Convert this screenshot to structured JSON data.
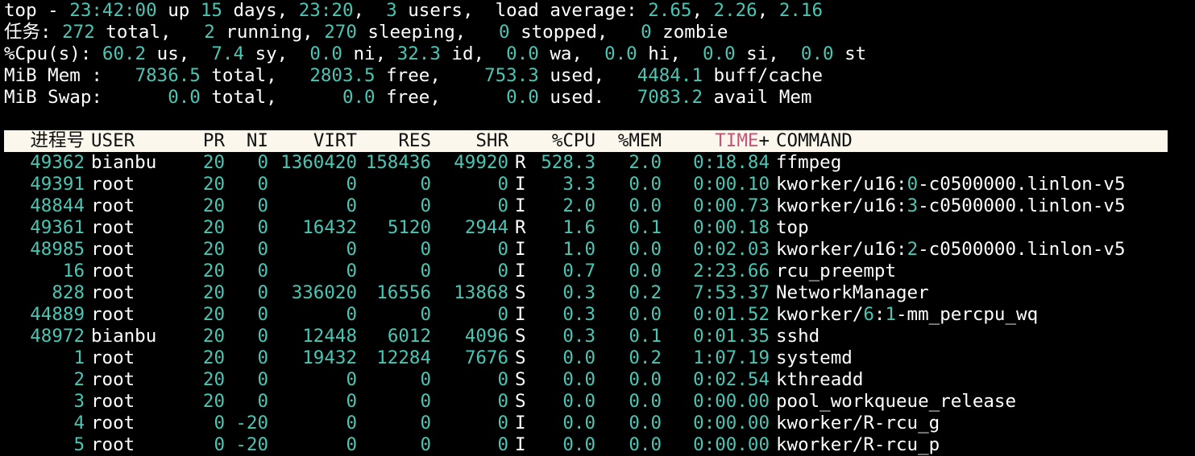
{
  "summary": {
    "line1": [
      {
        "t": "top - ",
        "c": "plain"
      },
      {
        "t": "23:42:00",
        "c": "num"
      },
      {
        "t": " up ",
        "c": "plain"
      },
      {
        "t": "15",
        "c": "num"
      },
      {
        "t": " days, ",
        "c": "plain"
      },
      {
        "t": "23:20",
        "c": "num"
      },
      {
        "t": ",  ",
        "c": "plain"
      },
      {
        "t": "3",
        "c": "num"
      },
      {
        "t": " users,  load average: ",
        "c": "plain"
      },
      {
        "t": "2.65",
        "c": "num"
      },
      {
        "t": ", ",
        "c": "plain"
      },
      {
        "t": "2.26",
        "c": "num"
      },
      {
        "t": ", ",
        "c": "plain"
      },
      {
        "t": "2.16",
        "c": "num"
      }
    ],
    "line2": [
      {
        "t": "任务",
        "c": "plain"
      },
      {
        "t": ": ",
        "c": "plain"
      },
      {
        "t": "272",
        "c": "num"
      },
      {
        "t": " total,   ",
        "c": "plain"
      },
      {
        "t": "2",
        "c": "num"
      },
      {
        "t": " running, ",
        "c": "plain"
      },
      {
        "t": "270",
        "c": "num"
      },
      {
        "t": " sleeping,   ",
        "c": "plain"
      },
      {
        "t": "0",
        "c": "num"
      },
      {
        "t": " stopped,   ",
        "c": "plain"
      },
      {
        "t": "0",
        "c": "num"
      },
      {
        "t": " zombie",
        "c": "plain"
      }
    ],
    "line3": [
      {
        "t": "%Cpu(s): ",
        "c": "plain"
      },
      {
        "t": "60.2",
        "c": "num"
      },
      {
        "t": " us,  ",
        "c": "plain"
      },
      {
        "t": "7.4",
        "c": "num"
      },
      {
        "t": " sy,  ",
        "c": "plain"
      },
      {
        "t": "0.0",
        "c": "num"
      },
      {
        "t": " ni, ",
        "c": "plain"
      },
      {
        "t": "32.3",
        "c": "num"
      },
      {
        "t": " id,  ",
        "c": "plain"
      },
      {
        "t": "0.0",
        "c": "num"
      },
      {
        "t": " wa,  ",
        "c": "plain"
      },
      {
        "t": "0.0",
        "c": "num"
      },
      {
        "t": " hi,  ",
        "c": "plain"
      },
      {
        "t": "0.0",
        "c": "num"
      },
      {
        "t": " si,  ",
        "c": "plain"
      },
      {
        "t": "0.0",
        "c": "num"
      },
      {
        "t": " st",
        "c": "plain"
      }
    ],
    "line4": [
      {
        "t": "MiB Mem :   ",
        "c": "plain"
      },
      {
        "t": "7836.5",
        "c": "num"
      },
      {
        "t": " total,   ",
        "c": "plain"
      },
      {
        "t": "2803.5",
        "c": "num"
      },
      {
        "t": " free,    ",
        "c": "plain"
      },
      {
        "t": "753.3",
        "c": "num"
      },
      {
        "t": " used,   ",
        "c": "plain"
      },
      {
        "t": "4484.1",
        "c": "num"
      },
      {
        "t": " buff/cache",
        "c": "plain"
      }
    ],
    "line5": [
      {
        "t": "MiB Swap:      ",
        "c": "plain"
      },
      {
        "t": "0.0",
        "c": "num"
      },
      {
        "t": " total,      ",
        "c": "plain"
      },
      {
        "t": "0.0",
        "c": "num"
      },
      {
        "t": " free,      ",
        "c": "plain"
      },
      {
        "t": "0.0",
        "c": "num"
      },
      {
        "t": " used.   ",
        "c": "plain"
      },
      {
        "t": "7083.2",
        "c": "num"
      },
      {
        "t": " avail Mem",
        "c": "plain"
      }
    ]
  },
  "table": {
    "headers": {
      "pid": "进程号",
      "user": "USER",
      "pr": "PR",
      "ni": "NI",
      "virt": "VIRT",
      "res": "RES",
      "shr": "SHR",
      "s": "",
      "cpu": "%CPU",
      "mem": "%MEM",
      "time_sorted": "TIME",
      "time_plus": "+",
      "command": "COMMAND"
    },
    "rows": [
      {
        "pid": "49362",
        "user": "bianbu",
        "pr": "20",
        "ni": "0",
        "virt": "1360420",
        "res": "158436",
        "shr": "49920",
        "s": "R",
        "cpu": "528.3",
        "mem": "2.0",
        "time": "0:18.84",
        "command": [
          {
            "t": "ffmpeg",
            "c": "w"
          }
        ]
      },
      {
        "pid": "49391",
        "user": "root",
        "pr": "20",
        "ni": "0",
        "virt": "0",
        "res": "0",
        "shr": "0",
        "s": "I",
        "cpu": "3.3",
        "mem": "0.0",
        "time": "0:00.10",
        "command": [
          {
            "t": "kworker/u16:",
            "c": "w"
          },
          {
            "t": "0",
            "c": "n"
          },
          {
            "t": "-c0500000.linlon-v5",
            "c": "w"
          }
        ]
      },
      {
        "pid": "48844",
        "user": "root",
        "pr": "20",
        "ni": "0",
        "virt": "0",
        "res": "0",
        "shr": "0",
        "s": "I",
        "cpu": "2.0",
        "mem": "0.0",
        "time": "0:00.73",
        "command": [
          {
            "t": "kworker/u16:",
            "c": "w"
          },
          {
            "t": "3",
            "c": "n"
          },
          {
            "t": "-c0500000.linlon-v5",
            "c": "w"
          }
        ]
      },
      {
        "pid": "49361",
        "user": "root",
        "pr": "20",
        "ni": "0",
        "virt": "16432",
        "res": "5120",
        "shr": "2944",
        "s": "R",
        "cpu": "1.6",
        "mem": "0.1",
        "time": "0:00.18",
        "command": [
          {
            "t": "top",
            "c": "w"
          }
        ]
      },
      {
        "pid": "48985",
        "user": "root",
        "pr": "20",
        "ni": "0",
        "virt": "0",
        "res": "0",
        "shr": "0",
        "s": "I",
        "cpu": "1.0",
        "mem": "0.0",
        "time": "0:02.03",
        "command": [
          {
            "t": "kworker/u16:",
            "c": "w"
          },
          {
            "t": "2",
            "c": "n"
          },
          {
            "t": "-c0500000.linlon-v5",
            "c": "w"
          }
        ]
      },
      {
        "pid": "16",
        "user": "root",
        "pr": "20",
        "ni": "0",
        "virt": "0",
        "res": "0",
        "shr": "0",
        "s": "I",
        "cpu": "0.7",
        "mem": "0.0",
        "time": "2:23.66",
        "command": [
          {
            "t": "rcu_preempt",
            "c": "w"
          }
        ]
      },
      {
        "pid": "828",
        "user": "root",
        "pr": "20",
        "ni": "0",
        "virt": "336020",
        "res": "16556",
        "shr": "13868",
        "s": "S",
        "cpu": "0.3",
        "mem": "0.2",
        "time": "7:53.37",
        "command": [
          {
            "t": "NetworkManager",
            "c": "w"
          }
        ]
      },
      {
        "pid": "44889",
        "user": "root",
        "pr": "20",
        "ni": "0",
        "virt": "0",
        "res": "0",
        "shr": "0",
        "s": "I",
        "cpu": "0.3",
        "mem": "0.0",
        "time": "0:01.52",
        "command": [
          {
            "t": "kworker/",
            "c": "w"
          },
          {
            "t": "6",
            "c": "n"
          },
          {
            "t": ":",
            "c": "w"
          },
          {
            "t": "1",
            "c": "n"
          },
          {
            "t": "-mm_percpu_wq",
            "c": "w"
          }
        ]
      },
      {
        "pid": "48972",
        "user": "bianbu",
        "pr": "20",
        "ni": "0",
        "virt": "12448",
        "res": "6012",
        "shr": "4096",
        "s": "S",
        "cpu": "0.3",
        "mem": "0.1",
        "time": "0:01.35",
        "command": [
          {
            "t": "sshd",
            "c": "w"
          }
        ]
      },
      {
        "pid": "1",
        "user": "root",
        "pr": "20",
        "ni": "0",
        "virt": "19432",
        "res": "12284",
        "shr": "7676",
        "s": "S",
        "cpu": "0.0",
        "mem": "0.2",
        "time": "1:07.19",
        "command": [
          {
            "t": "systemd",
            "c": "w"
          }
        ]
      },
      {
        "pid": "2",
        "user": "root",
        "pr": "20",
        "ni": "0",
        "virt": "0",
        "res": "0",
        "shr": "0",
        "s": "S",
        "cpu": "0.0",
        "mem": "0.0",
        "time": "0:02.54",
        "command": [
          {
            "t": "kthreadd",
            "c": "w"
          }
        ]
      },
      {
        "pid": "3",
        "user": "root",
        "pr": "20",
        "ni": "0",
        "virt": "0",
        "res": "0",
        "shr": "0",
        "s": "S",
        "cpu": "0.0",
        "mem": "0.0",
        "time": "0:00.00",
        "command": [
          {
            "t": "pool_workqueue_release",
            "c": "w"
          }
        ]
      },
      {
        "pid": "4",
        "user": "root",
        "pr": "0",
        "ni": "-20",
        "virt": "0",
        "res": "0",
        "shr": "0",
        "s": "I",
        "cpu": "0.0",
        "mem": "0.0",
        "time": "0:00.00",
        "command": [
          {
            "t": "kworker/R-rcu_g",
            "c": "w"
          }
        ]
      },
      {
        "pid": "5",
        "user": "root",
        "pr": "0",
        "ni": "-20",
        "virt": "0",
        "res": "0",
        "shr": "0",
        "s": "I",
        "cpu": "0.0",
        "mem": "0.0",
        "time": "0:00.00",
        "command": [
          {
            "t": "kworker/R-rcu_p",
            "c": "w"
          }
        ]
      }
    ]
  },
  "colors": {
    "background": "#000000",
    "number_accent": "#49c6b4",
    "text": "#ffffff",
    "header_bar": "#fcf7ec",
    "sort_column": "#c2567a"
  }
}
